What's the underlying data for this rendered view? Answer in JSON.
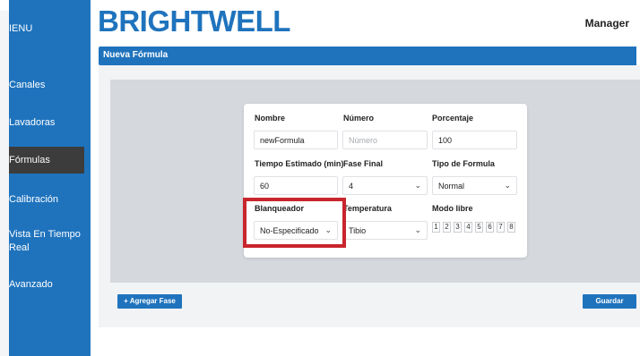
{
  "sidebar": {
    "menu_label": "IENU",
    "items": [
      {
        "label": "Canales",
        "active": false
      },
      {
        "label": "Lavadoras",
        "active": false
      },
      {
        "label": "Fórmulas",
        "active": true
      },
      {
        "label": "Calibración",
        "active": false
      },
      {
        "label": "Vista En Tiempo Real",
        "line1": "Vista En Tiempo",
        "line2": "Real",
        "active": false
      },
      {
        "label": "Avanzado",
        "active": false
      }
    ]
  },
  "header": {
    "logo": "BRIGHTWELL",
    "user": "Manager"
  },
  "section": {
    "title": "Nueva Fórmula"
  },
  "form": {
    "nombre": {
      "label": "Nombre",
      "value": "newFormula"
    },
    "numero": {
      "label": "Número",
      "placeholder": "Número"
    },
    "porcentaje": {
      "label": "Porcentaje",
      "value": "100"
    },
    "tiempo": {
      "label": "Tiempo Estimado (min)",
      "value": "60"
    },
    "fase_final": {
      "label": "Fase Final",
      "value": "4"
    },
    "tipo": {
      "label": "Tipo de Formula",
      "value": "Normal"
    },
    "blanqueador": {
      "label": "Blanqueador",
      "value": "No-Especificado"
    },
    "temperatura": {
      "label": "Temperatura",
      "value": "Tibio"
    },
    "modo_libre": {
      "label": "Modo libre",
      "options": [
        "1",
        "2",
        "3",
        "4",
        "5",
        "6",
        "7",
        "8"
      ]
    }
  },
  "actions": {
    "add_phase": "+ Agregar Fase",
    "save": "Guardar"
  },
  "colors": {
    "brand": "#1f73bd",
    "highlight": "#c8252c"
  }
}
